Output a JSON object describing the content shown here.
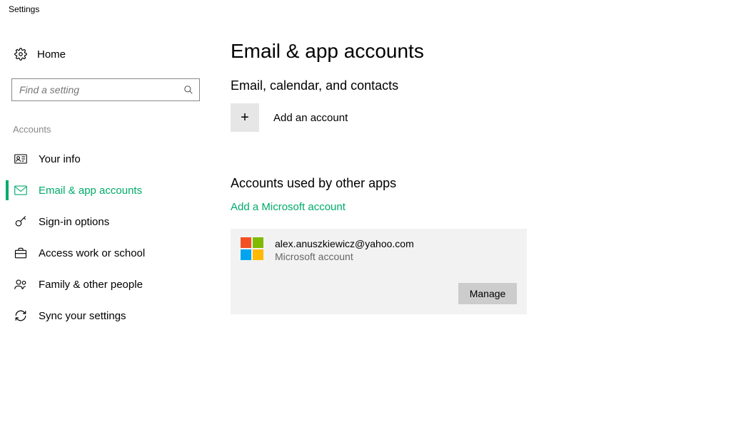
{
  "window": {
    "title": "Settings"
  },
  "sidebar": {
    "home_label": "Home",
    "search_placeholder": "Find a setting",
    "section_label": "Accounts",
    "items": [
      {
        "label": "Your info"
      },
      {
        "label": "Email & app accounts"
      },
      {
        "label": "Sign-in options"
      },
      {
        "label": "Access work or school"
      },
      {
        "label": "Family & other people"
      },
      {
        "label": "Sync your settings"
      }
    ]
  },
  "main": {
    "page_title": "Email & app accounts",
    "section1_title": "Email, calendar, and contacts",
    "add_account_label": "Add an account",
    "section2_title": "Accounts used by other apps",
    "add_ms_link": "Add a Microsoft account",
    "account": {
      "email": "alex.anuszkiewicz@yahoo.com",
      "type": "Microsoft account",
      "manage_label": "Manage"
    }
  }
}
